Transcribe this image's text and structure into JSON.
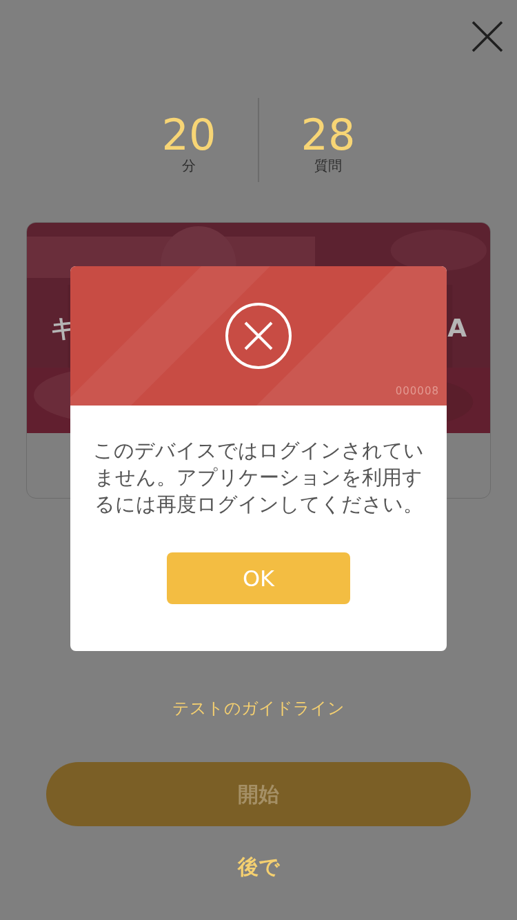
{
  "stats": [
    {
      "value": "20",
      "label": "分"
    },
    {
      "value": "28",
      "label": "質問"
    }
  ],
  "card": {
    "title_fragments": [
      "キ",
      "A"
    ]
  },
  "guideline_link": "テストのガイドライン",
  "start_button": "開始",
  "later_link": "後で",
  "dialog": {
    "code": "000008",
    "message": "このデバイスではログインされていません。アプリケーションを利用するには再度ログインしてください。",
    "ok_button": "OK"
  }
}
